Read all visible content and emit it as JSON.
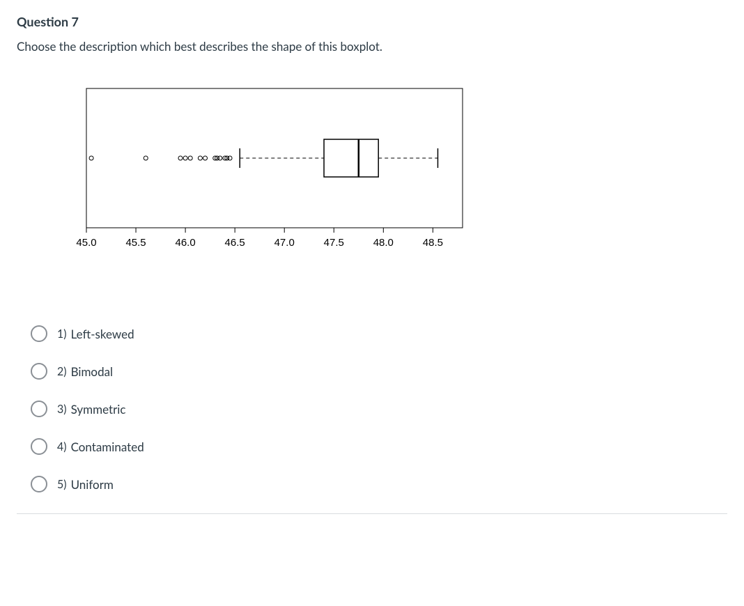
{
  "question": {
    "title": "Question 7",
    "prompt": "Choose the description which best describes the shape of this boxplot."
  },
  "chart_data": {
    "type": "boxplot",
    "x_ticks": [
      45.0,
      45.5,
      46.0,
      46.5,
      47.0,
      47.5,
      48.0,
      48.5
    ],
    "x_tick_labels": [
      "45.0",
      "45.5",
      "46.0",
      "46.5",
      "47.0",
      "47.5",
      "48.0",
      "48.5"
    ],
    "xlim": [
      45.0,
      48.8
    ],
    "box": {
      "q1": 47.4,
      "median": 47.75,
      "q3": 47.95,
      "whisker_low": 46.55,
      "whisker_high": 48.55
    },
    "outliers": [
      45.05,
      45.6,
      45.95,
      46.0,
      46.05,
      46.15,
      46.2,
      46.3,
      46.32,
      46.35,
      46.4,
      46.42,
      46.45
    ]
  },
  "options": [
    {
      "num": "1)",
      "label": "Left-skewed"
    },
    {
      "num": "2)",
      "label": "Bimodal"
    },
    {
      "num": "3)",
      "label": "Symmetric"
    },
    {
      "num": "4)",
      "label": "Contaminated"
    },
    {
      "num": "5)",
      "label": "Uniform"
    }
  ]
}
